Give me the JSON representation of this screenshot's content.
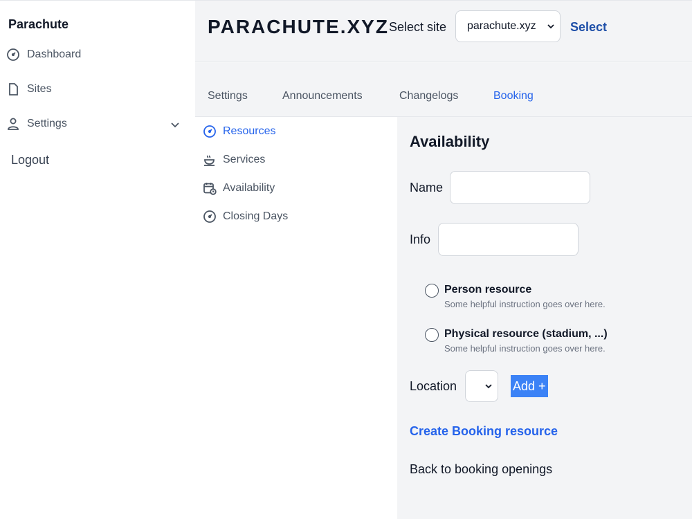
{
  "sidebar": {
    "brand": "Parachute",
    "items": [
      {
        "label": "Dashboard",
        "icon": "gauge-icon"
      },
      {
        "label": "Sites",
        "icon": "file-icon"
      },
      {
        "label": "Settings",
        "icon": "user-icon"
      }
    ],
    "logout": "Logout"
  },
  "header": {
    "site_title": "PARACHUTE.XYZ",
    "select_label": "Select site",
    "site_value": "parachute.xyz",
    "select_button": "Select"
  },
  "tabs": [
    {
      "label": "Settings",
      "active": false
    },
    {
      "label": "Announcements",
      "active": false
    },
    {
      "label": "Changelogs",
      "active": false
    },
    {
      "label": "Booking",
      "active": true
    }
  ],
  "subnav": [
    {
      "label": "Resources",
      "icon": "gauge-icon",
      "active": true
    },
    {
      "label": "Services",
      "icon": "coffee-icon",
      "active": false
    },
    {
      "label": "Availability",
      "icon": "calendar-clock-icon",
      "active": false
    },
    {
      "label": "Closing Days",
      "icon": "gauge-icon",
      "active": false
    }
  ],
  "form": {
    "title": "Availability",
    "name_label": "Name",
    "name_value": "",
    "info_label": "Info",
    "info_value": "",
    "radios": [
      {
        "label": "Person resource",
        "help": "Some helpful instruction goes over here.",
        "checked": false
      },
      {
        "label": "Physical resource (stadium, ...)",
        "help": "Some helpful instruction goes over here.",
        "checked": false
      }
    ],
    "location_label": "Location",
    "location_value": "",
    "add_button": "Add +",
    "create_link": "Create Booking resource",
    "back_link": "Back to booking openings"
  },
  "colors": {
    "accent": "#2563eb",
    "button": "#3b82f6",
    "panel_bg": "#f3f4f6"
  }
}
